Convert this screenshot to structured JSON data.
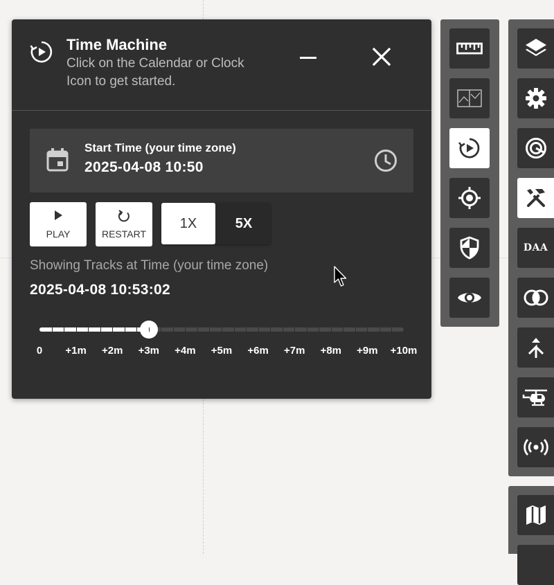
{
  "panel": {
    "title": "Time Machine",
    "subtitle": "Click on the Calendar or Clock Icon to get started.",
    "start_time": {
      "label": "Start Time (your time zone)",
      "value": "2025-04-08 10:50"
    },
    "controls": {
      "play_label": "PLAY",
      "restart_label": "RESTART",
      "speed_options": [
        "1X",
        "5X"
      ],
      "selected_speed": "1X"
    },
    "showing": {
      "label": "Showing Tracks at Time (your time zone)",
      "value": "2025-04-08 10:53:02"
    },
    "slider": {
      "progress": 0.3,
      "tick_labels": [
        "0",
        "+1m",
        "+2m",
        "+3m",
        "+4m",
        "+5m",
        "+6m",
        "+7m",
        "+8m",
        "+9m",
        "+10m"
      ]
    }
  },
  "toolbar_primary": {
    "items": [
      {
        "icon": "ruler-icon",
        "active": false
      },
      {
        "icon": "map-compare-icon",
        "active": false
      },
      {
        "icon": "time-machine-icon",
        "active": true
      },
      {
        "icon": "crosshair-icon",
        "active": false
      },
      {
        "icon": "shield-icon",
        "active": false
      },
      {
        "icon": "eye-icon",
        "active": false
      }
    ]
  },
  "toolbar_secondary": {
    "items": [
      {
        "icon": "layers-icon",
        "active": false
      },
      {
        "icon": "gear-icon",
        "active": false
      },
      {
        "icon": "target-circle-icon",
        "active": false
      },
      {
        "icon": "tools-icon",
        "active": true
      },
      {
        "icon": "daa-icon",
        "label": "DAA",
        "active": false
      },
      {
        "icon": "overlap-circles-icon",
        "active": false
      },
      {
        "icon": "merge-arrow-icon",
        "active": false
      },
      {
        "icon": "helicopter-icon",
        "active": false
      },
      {
        "icon": "broadcast-icon",
        "active": false
      }
    ]
  },
  "toolbar_tertiary": {
    "items": [
      {
        "icon": "map-icon",
        "active": false
      }
    ]
  },
  "colors": {
    "panel_bg": "#2f2f2f",
    "toolbar_bg": "#5c5c5c",
    "button_bg": "#333333",
    "active_bg": "#ffffff",
    "map_bg": "#f4f3f1"
  }
}
